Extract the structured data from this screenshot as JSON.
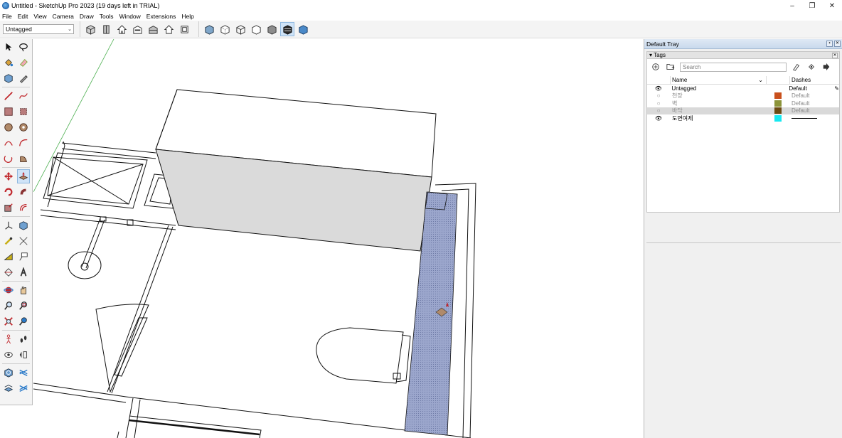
{
  "window": {
    "title": "Untitled - SketchUp Pro 2023 (19 days left in TRIAL)",
    "controls": {
      "minimize": "–",
      "restore": "❐",
      "close": "✕"
    }
  },
  "menu": [
    "File",
    "Edit",
    "View",
    "Camera",
    "Draw",
    "Tools",
    "Window",
    "Extensions",
    "Help"
  ],
  "toolbar": {
    "tag_select": "Untagged",
    "views_group": [
      "iso-view-icon",
      "top-view-icon",
      "front-view-icon",
      "right-view-icon",
      "back-view-icon",
      "left-view-icon",
      "bottom-view-icon"
    ],
    "styles_group": [
      "xray-icon",
      "back-edges-icon",
      "wireframe-icon",
      "hidden-line-icon",
      "shaded-icon",
      "shaded-textures-icon",
      "monochrome-icon"
    ]
  },
  "tray": {
    "title": "Default Tray",
    "panel_title": "Tags",
    "search_placeholder": "Search",
    "columns": {
      "name": "Name",
      "dashes": "Dashes"
    },
    "tags": [
      {
        "visible": true,
        "name": "Untagged",
        "color": "",
        "dashes": "Default",
        "active": true,
        "selected": false
      },
      {
        "visible": false,
        "name": "천장",
        "color": "#c9501c",
        "dashes": "Default",
        "active": false,
        "selected": false
      },
      {
        "visible": false,
        "name": "벽",
        "color": "#8c943a",
        "dashes": "Default",
        "active": false,
        "selected": false
      },
      {
        "visible": false,
        "name": "바닥",
        "color": "#6b4a12",
        "dashes": "Default",
        "active": false,
        "selected": true
      },
      {
        "visible": true,
        "name": "도면여제",
        "color": "#17e8f0",
        "dashes": "",
        "active": false,
        "selected": false
      }
    ]
  },
  "colors": {
    "toolbar_bg": "#f4f4f4",
    "tray_header": "#c9d9ec",
    "selected_row": "#d9d9d9",
    "shelf_fill": "#9ba6cc",
    "box_side": "#dadada"
  }
}
